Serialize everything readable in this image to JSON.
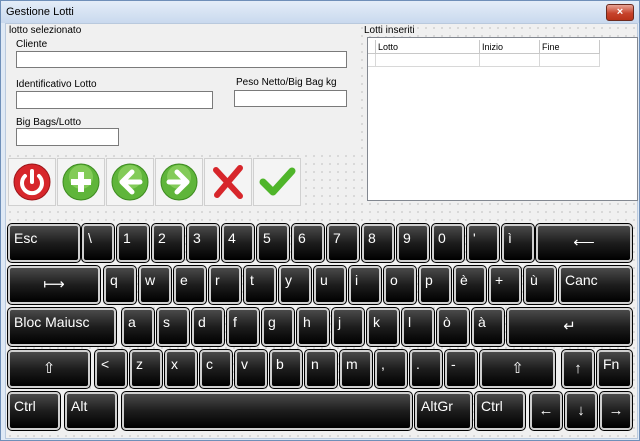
{
  "window": {
    "title": "Gestione Lotti",
    "close_glyph": "×"
  },
  "lotto_selezionato": {
    "group_label": "lotto selezionato",
    "cliente_label": "Cliente",
    "cliente_value": "",
    "identificativo_label": "Identificativo Lotto",
    "identificativo_value": "",
    "peso_label": "Peso Netto/Big Bag kg",
    "peso_value": "",
    "bigbags_label": "Big Bags/Lotto",
    "bigbags_value": ""
  },
  "lotti_inseriti": {
    "group_label": "Lotti inseriti",
    "columns": [
      "Lotto",
      "Inizio",
      "Fine"
    ]
  },
  "toolbar": {
    "buttons": [
      {
        "name": "power-button",
        "icon": "power-icon",
        "color": "#d7262b"
      },
      {
        "name": "add-button",
        "icon": "plus-icon",
        "color": "#5fb53a"
      },
      {
        "name": "back-button",
        "icon": "arrow-left-icon",
        "color": "#5fb53a"
      },
      {
        "name": "forward-button",
        "icon": "arrow-right-icon",
        "color": "#5fb53a"
      },
      {
        "name": "delete-button",
        "icon": "x-icon",
        "color": "#d7262b"
      },
      {
        "name": "confirm-button",
        "icon": "check-icon",
        "color": "#4fb52a"
      }
    ]
  },
  "keyboard": {
    "row1": [
      "Esc",
      "\\",
      "1",
      "2",
      "3",
      "4",
      "5",
      "6",
      "7",
      "8",
      "9",
      "0",
      "'",
      "ì",
      "⟵"
    ],
    "row2": [
      "⟼",
      "q",
      "w",
      "e",
      "r",
      "t",
      "y",
      "u",
      "i",
      "o",
      "p",
      "è",
      "+",
      "ù",
      "Canc"
    ],
    "row3": [
      "Bloc Maiusc",
      "a",
      "s",
      "d",
      "f",
      "g",
      "h",
      "j",
      "k",
      "l",
      "ò",
      "à",
      "↵"
    ],
    "row4": [
      "⇧",
      "<",
      "z",
      "x",
      "c",
      "v",
      "b",
      "n",
      "m",
      ",",
      ".",
      "-",
      "⇧",
      "↑",
      "Fn"
    ],
    "row5": [
      "Ctrl",
      "Alt",
      "",
      "AltGr",
      "Ctrl",
      "←",
      "↓",
      "→"
    ]
  }
}
